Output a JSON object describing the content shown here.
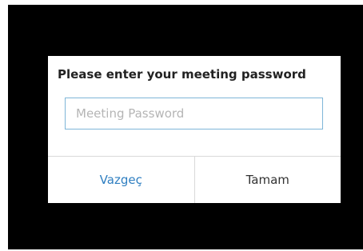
{
  "dialog": {
    "title": "Please enter your meeting password",
    "password_input": {
      "value": "",
      "placeholder": "Meeting Password"
    },
    "cancel_label": "Vazgeç",
    "ok_label": "Tamam"
  },
  "colors": {
    "background": "#000000",
    "dialog": "#ffffff",
    "input_border": "#7fb6d8",
    "cancel_text": "#2f7fc1",
    "ok_text": "#333333"
  }
}
